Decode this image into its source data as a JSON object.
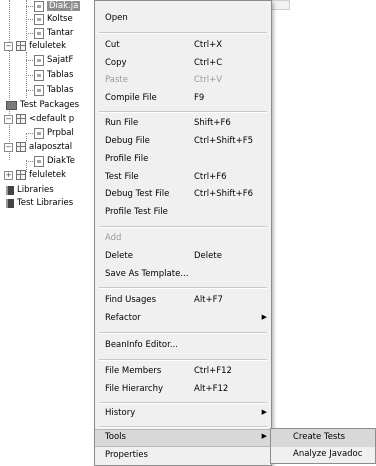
{
  "tree": {
    "items": [
      {
        "label": "Diak.ja",
        "kind": "file",
        "selected": true
      },
      {
        "label": "Koltse",
        "kind": "file"
      },
      {
        "label": "Tantar",
        "kind": "file"
      },
      {
        "label": "feluletek",
        "kind": "package"
      },
      {
        "label": "SajatF",
        "kind": "file"
      },
      {
        "label": "Tablas",
        "kind": "file"
      },
      {
        "label": "Tablas",
        "kind": "file"
      },
      {
        "label": "Test Packages",
        "kind": "folder"
      },
      {
        "label": "<default p",
        "kind": "package"
      },
      {
        "label": "Prpbal",
        "kind": "file"
      },
      {
        "label": "alaposztal",
        "kind": "package"
      },
      {
        "label": "DiakTe",
        "kind": "file"
      },
      {
        "label": "feluletek",
        "kind": "package"
      },
      {
        "label": "Libraries",
        "kind": "library"
      },
      {
        "label": "Test Libraries",
        "kind": "library"
      }
    ]
  },
  "context_menu": {
    "items": {
      "open": {
        "label": "Open"
      },
      "cut": {
        "label": "Cut",
        "shortcut": "Ctrl+X"
      },
      "copy": {
        "label": "Copy",
        "shortcut": "Ctrl+C"
      },
      "paste": {
        "label": "Paste",
        "shortcut": "Ctrl+V"
      },
      "compile_file": {
        "label": "Compile File",
        "shortcut": "F9"
      },
      "run_file": {
        "label": "Run File",
        "shortcut": "Shift+F6"
      },
      "debug_file": {
        "label": "Debug File",
        "shortcut": "Ctrl+Shift+F5"
      },
      "profile_file": {
        "label": "Profile File"
      },
      "test_file": {
        "label": "Test File",
        "shortcut": "Ctrl+F6"
      },
      "debug_test_file": {
        "label": "Debug Test File",
        "shortcut": "Ctrl+Shift+F6"
      },
      "profile_test_file": {
        "label": "Profile Test File"
      },
      "add": {
        "label": "Add"
      },
      "delete": {
        "label": "Delete",
        "shortcut": "Delete"
      },
      "save_as_template": {
        "label": "Save As Template..."
      },
      "find_usages": {
        "label": "Find Usages",
        "shortcut": "Alt+F7"
      },
      "refactor": {
        "label": "Refactor"
      },
      "beaninfo_editor": {
        "label": "BeanInfo Editor..."
      },
      "file_members": {
        "label": "File Members",
        "shortcut": "Ctrl+F12"
      },
      "file_hierarchy": {
        "label": "File Hierarchy",
        "shortcut": "Alt+F12"
      },
      "history": {
        "label": "History"
      },
      "tools": {
        "label": "Tools"
      },
      "properties": {
        "label": "Properties"
      }
    }
  },
  "tools_submenu": {
    "items": {
      "create_tests": {
        "label": "Create Tests"
      },
      "analyze_javadoc": {
        "label": "Analyze Javadoc"
      }
    }
  }
}
